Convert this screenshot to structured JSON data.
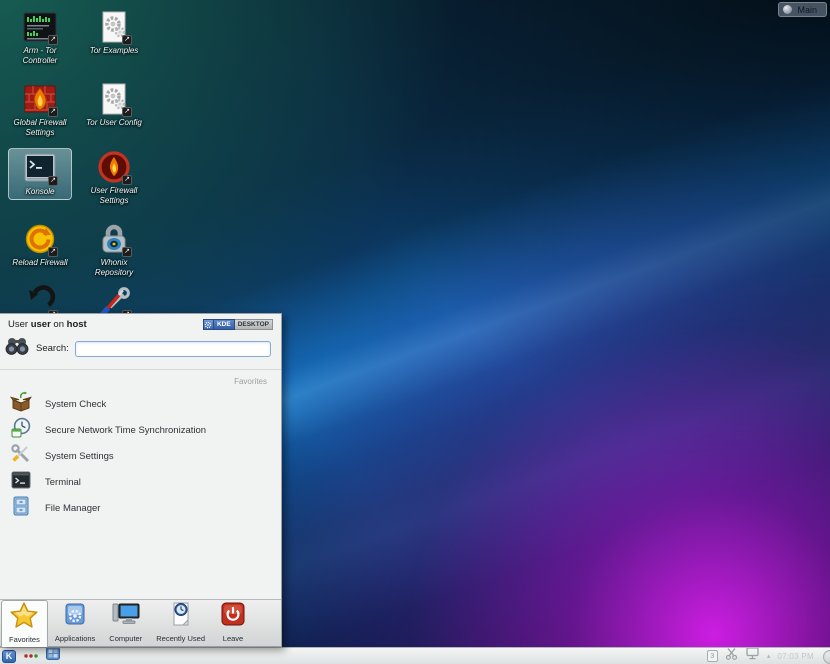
{
  "activity": {
    "label": "Main"
  },
  "desktop_icons": [
    {
      "label": "Arm - Tor Controller"
    },
    {
      "label": "Tor Examples"
    },
    {
      "label": "Global Firewall Settings"
    },
    {
      "label": "Tor User Config"
    },
    {
      "label": "Konsole"
    },
    {
      "label": "User Firewall Settings"
    },
    {
      "label": "Reload Firewall"
    },
    {
      "label": "Whonix Repository"
    }
  ],
  "launcher": {
    "header": {
      "lead": "User",
      "user": "user",
      "conj": "on",
      "host": "host"
    },
    "branding": {
      "kde": "KDE",
      "desktop": "DESKTOP"
    },
    "search": {
      "label": "Search:",
      "value": ""
    },
    "section": "Favorites",
    "favorites": [
      {
        "label": "System Check"
      },
      {
        "label": "Secure Network Time Synchronization"
      },
      {
        "label": "System Settings"
      },
      {
        "label": "Terminal"
      },
      {
        "label": "File Manager"
      }
    ],
    "tabs": [
      {
        "label": "Favorites"
      },
      {
        "label": "Applications"
      },
      {
        "label": "Computer"
      },
      {
        "label": "Recently Used"
      },
      {
        "label": "Leave"
      }
    ]
  },
  "taskbar": {
    "clock": "07:03 PM",
    "tray": {
      "badge": "3"
    }
  },
  "icons": {
    "shortcut_emblem": "↗",
    "tray_expand": "▴",
    "kmenu_letter": "K"
  },
  "colors": {
    "accent_blue": "#1472c8",
    "magenta": "#b312d6",
    "teal": "#1a6c5c",
    "panel": "#e8eaea",
    "leave_red": "#c0271c"
  }
}
